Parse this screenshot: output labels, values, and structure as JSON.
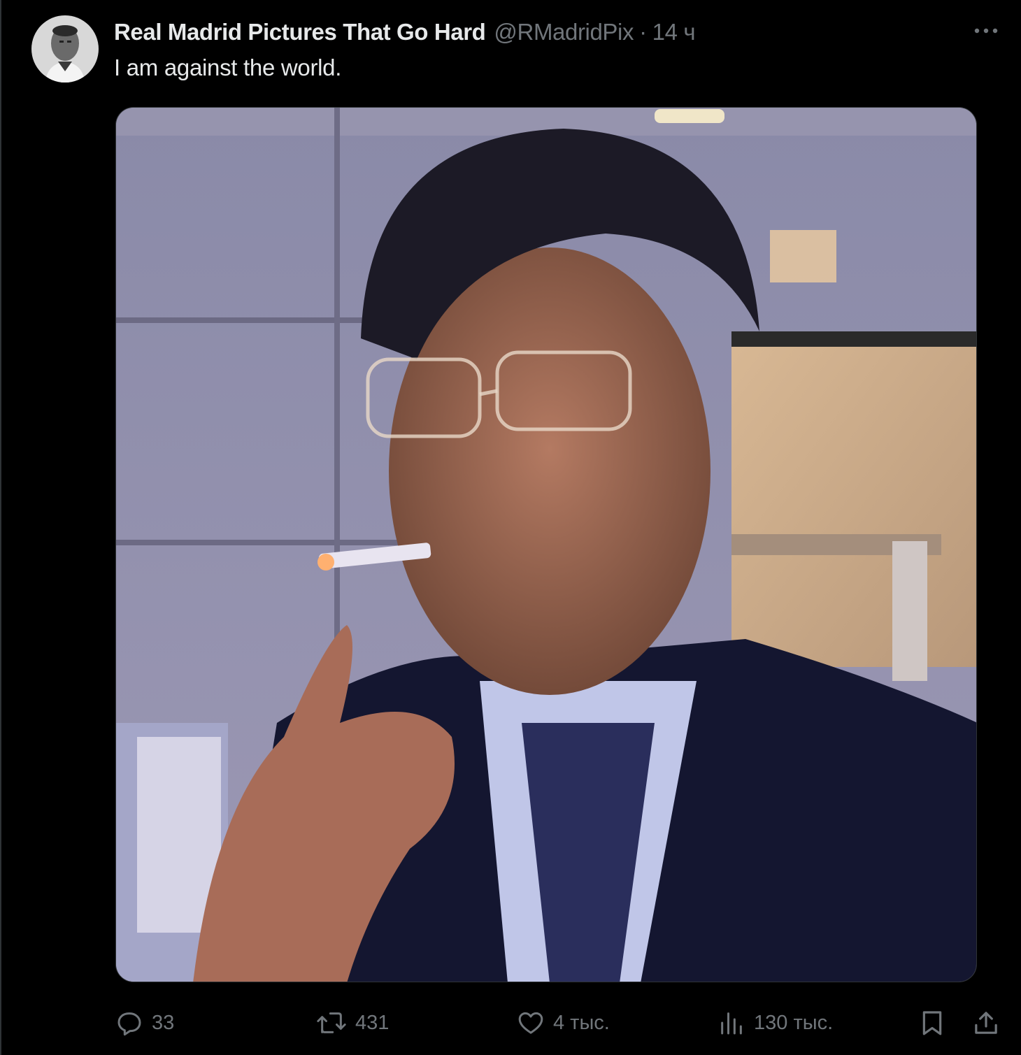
{
  "tweet": {
    "author_name": "Real Madrid Pictures That Go Hard",
    "author_handle": "@RMadridPix",
    "separator": "·",
    "time": "14 ч",
    "text": "I am against the world."
  },
  "icons": {
    "more": "more-horizontal-icon",
    "reply": "reply-icon",
    "retweet": "retweet-icon",
    "like": "heart-icon",
    "views": "views-icon",
    "bookmark": "bookmark-icon",
    "share": "share-icon"
  },
  "metrics": {
    "replies": "33",
    "retweets": "431",
    "likes": "4 тыс.",
    "views": "130 тыс."
  },
  "colors": {
    "background": "#000000",
    "text_primary": "#e7e9ea",
    "text_secondary": "#71767b",
    "border": "#2f3336"
  }
}
